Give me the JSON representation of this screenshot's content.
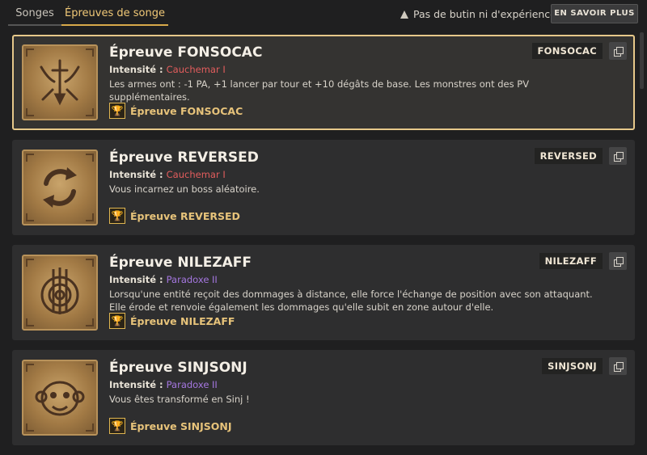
{
  "tabs": [
    {
      "label": "Songes"
    },
    {
      "label": "Épreuves de songe"
    }
  ],
  "notice": {
    "text": "Pas de butin ni d'expérience",
    "icon": "warning-icon"
  },
  "info_button": {
    "label": "EN SAVOIR PLUS"
  },
  "intensity_label": "Intensité : ",
  "cards": [
    {
      "title": "Épreuve FONSOCAC",
      "intensity": "Cauchemar I",
      "intensity_kind": "cauchemar",
      "description": "Les armes ont : -1 PA, +1 lancer par tour et +10 dégâts de base. Les monstres ont des PV supplémentaires.",
      "reward": "Épreuve FONSOCAC",
      "code": "FONSOCAC",
      "icon": "crossed-swords-emblem-icon",
      "selected": true
    },
    {
      "title": "Épreuve REVERSED",
      "intensity": "Cauchemar I",
      "intensity_kind": "cauchemar",
      "description": "Vous incarnez un boss aléatoire.",
      "reward": "Épreuve REVERSED",
      "code": "REVERSED",
      "icon": "circular-arrows-icon",
      "selected": false
    },
    {
      "title": "Épreuve NILEZAFF",
      "intensity": "Paradoxe II",
      "intensity_kind": "paradoxe",
      "description": "Lorsqu'une entité reçoit des dommages à distance, elle force l'échange de position avec son attaquant. Elle érode et renvoie également les dommages qu'elle subit en zone autour d'elle.",
      "reward": "Épreuve NILEZAFF",
      "code": "NILEZAFF",
      "icon": "arrows-target-icon",
      "selected": false
    },
    {
      "title": "Épreuve SINJSONJ",
      "intensity": "Paradoxe II",
      "intensity_kind": "paradoxe",
      "description": "Vous êtes transformé en Sinj !",
      "reward": "Épreuve SINJSONJ",
      "code": "SINJSONJ",
      "icon": "monkey-face-icon",
      "selected": false
    }
  ],
  "colors": {
    "accent": "#d8a94a",
    "cauchemar": "#e35d5d",
    "paradoxe": "#a577e0",
    "reward": "#e7c37a"
  }
}
